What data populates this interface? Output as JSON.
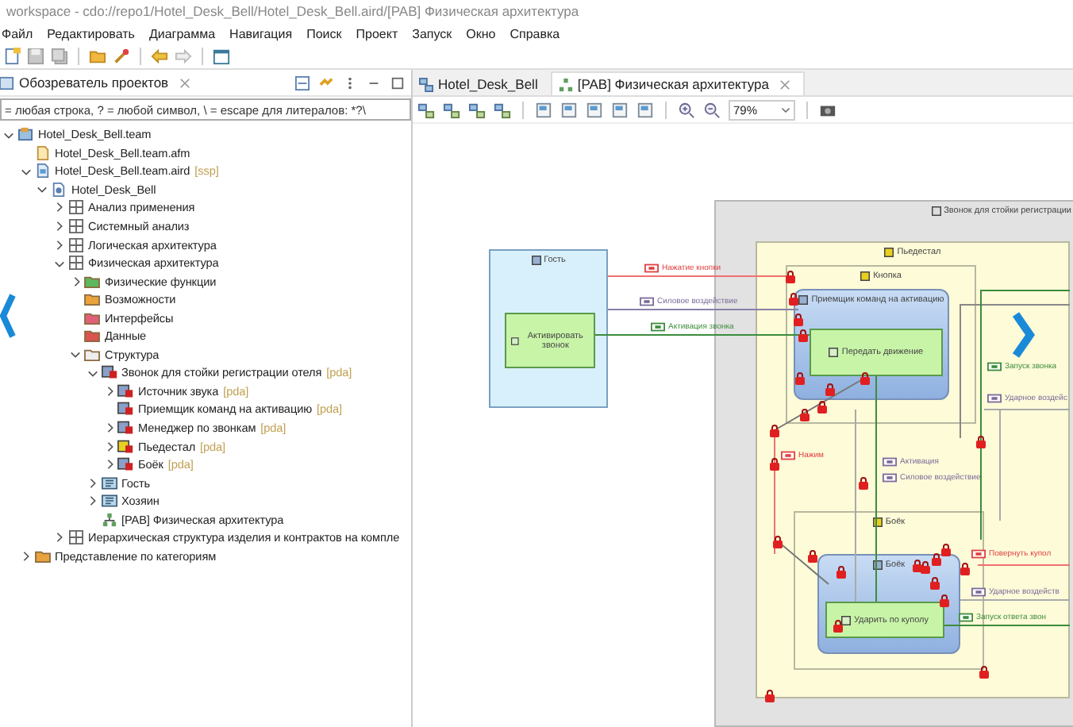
{
  "window": {
    "title": "workspace - cdo://repo1/Hotel_Desk_Bell/Hotel_Desk_Bell.aird/[PAB] Физическая архитектура"
  },
  "menu": [
    "Файл",
    "Редактировать",
    "Диаграмма",
    "Навигация",
    "Поиск",
    "Проект",
    "Запуск",
    "Окно",
    "Справка"
  ],
  "explorer": {
    "title": "Обозреватель проектов",
    "filter": {
      "placeholder": "= любая строка, ? = любой символ, \\ = escape для литералов: *?\\"
    },
    "tree": [
      {
        "label": "Hotel_Desk_Bell.team",
        "kind": "project",
        "toggle": true,
        "expanded": true,
        "children": [
          {
            "label": "Hotel_Desk_Bell.team.afm",
            "kind": "afm"
          },
          {
            "label": "Hotel_Desk_Bell.team.aird",
            "suffix": "[ssp]",
            "kind": "aird",
            "toggle": true,
            "expanded": true,
            "children": [
              {
                "label": "Hotel_Desk_Bell",
                "kind": "model",
                "toggle": true,
                "expanded": true,
                "children": [
                  {
                    "label": "Анализ применения",
                    "kind": "layer",
                    "toggle": true,
                    "expanded": false
                  },
                  {
                    "label": "Системный анализ",
                    "kind": "layer",
                    "toggle": true,
                    "expanded": false
                  },
                  {
                    "label": "Логическая архитектура",
                    "kind": "layer",
                    "toggle": true,
                    "expanded": false
                  },
                  {
                    "label": "Физическая архитектура",
                    "kind": "layer",
                    "toggle": true,
                    "expanded": true,
                    "children": [
                      {
                        "label": "Физические функции",
                        "kind": "folder",
                        "color": "#5cb85c",
                        "toggle": true,
                        "expanded": false
                      },
                      {
                        "label": "Возможности",
                        "kind": "folder",
                        "color": "#e8a33c"
                      },
                      {
                        "label": "Интерфейсы",
                        "kind": "folder",
                        "color": "#e0607a"
                      },
                      {
                        "label": "Данные",
                        "kind": "folder",
                        "color": "#d9534f"
                      },
                      {
                        "label": "Структура",
                        "kind": "folder",
                        "color": "#eeeeee",
                        "toggle": true,
                        "expanded": true,
                        "children": [
                          {
                            "label": "Звонок для стойки регистрации отеля",
                            "suffix": "[pda]",
                            "kind": "behavior",
                            "toggle": true,
                            "expanded": true,
                            "children": [
                              {
                                "label": "Источник звука",
                                "suffix": "[pda]",
                                "kind": "behavior",
                                "toggle": true,
                                "expanded": false
                              },
                              {
                                "label": "Приемщик команд на активацию",
                                "suffix": "[pda]",
                                "kind": "behavior"
                              },
                              {
                                "label": "Менеджер по звонкам",
                                "suffix": "[pda]",
                                "kind": "behavior",
                                "toggle": true,
                                "expanded": false
                              },
                              {
                                "label": "Пьедестал",
                                "suffix": "[pda]",
                                "kind": "node",
                                "toggle": true,
                                "expanded": false
                              },
                              {
                                "label": "Боёк",
                                "suffix": "[pda]",
                                "kind": "behavior",
                                "toggle": true,
                                "expanded": false
                              }
                            ]
                          },
                          {
                            "label": "Гость",
                            "kind": "actor",
                            "toggle": true,
                            "expanded": false
                          },
                          {
                            "label": "Хозяин",
                            "kind": "actor",
                            "toggle": true,
                            "expanded": false
                          },
                          {
                            "label": "[PAB] Физическая архитектура",
                            "kind": "diagram"
                          }
                        ]
                      }
                    ]
                  },
                  {
                    "label": "Иерархическая структура изделия и контрактов на компле",
                    "kind": "layer",
                    "toggle": true,
                    "expanded": false
                  }
                ]
              }
            ]
          },
          {
            "label": "Представление по категориям",
            "kind": "folder",
            "color": "#e8a33c",
            "toggle": true,
            "expanded": false
          }
        ]
      }
    ]
  },
  "editor": {
    "tabs": [
      {
        "label": "Hotel_Desk_Bell",
        "kind": "model",
        "selected": false
      },
      {
        "label": "[PAB] Физическая архитектура",
        "kind": "diagram",
        "selected": true
      }
    ],
    "zoom": "79%",
    "diagram": {
      "frame": "Звонок для стойки регистрации",
      "nodes": [
        {
          "label": "Пьедестал",
          "kind": "node"
        },
        {
          "label": "Кнопка",
          "kind": "node"
        },
        {
          "label": "Приемщик команд на активацию",
          "kind": "behavior"
        },
        {
          "label": "Передать движение",
          "kind": "function"
        },
        {
          "label": "Гость",
          "kind": "actor"
        },
        {
          "label": "Активировать звонок",
          "kind": "function"
        },
        {
          "label": "Боёк",
          "kind": "node"
        },
        {
          "label": "Боёк",
          "kind": "behavior"
        },
        {
          "label": "Ударить по куполу",
          "kind": "function"
        }
      ],
      "exchanges": [
        {
          "label": "Нажатие кнопки",
          "color": "#e04040"
        },
        {
          "label": "Силовое воздействие",
          "color": "#7a6a9a"
        },
        {
          "label": "Активация звонка",
          "color": "#3c8c3c"
        },
        {
          "label": "Запуск звонка",
          "color": "#3c8c3c"
        },
        {
          "label": "Ударное воздейс",
          "color": "#7a6a9a"
        },
        {
          "label": "Нажим",
          "color": "#e04040"
        },
        {
          "label": "Активация",
          "color": "#7a6a9a"
        },
        {
          "label": "Силовое воздействие",
          "color": "#7a6a9a"
        },
        {
          "label": "Повернуть купол",
          "color": "#e04040"
        },
        {
          "label": "Ударное воздейств",
          "color": "#7a6a9a"
        },
        {
          "label": "Запуск ответа звон",
          "color": "#3c8c3c"
        }
      ]
    }
  }
}
